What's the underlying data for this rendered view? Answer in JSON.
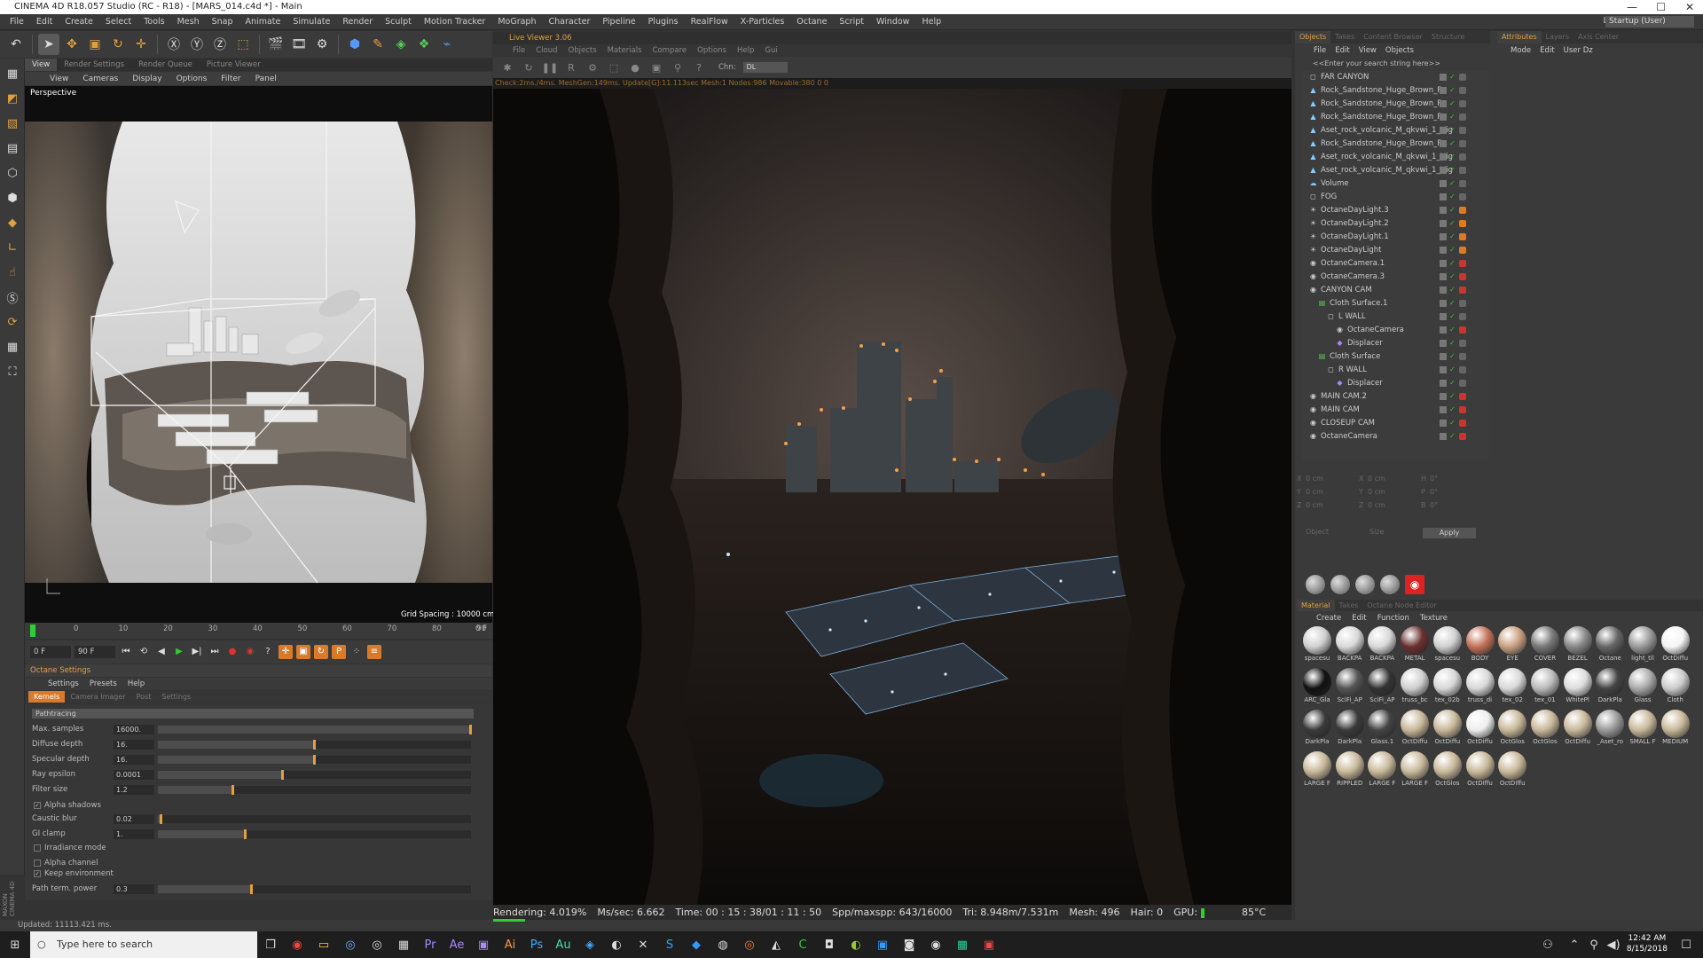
{
  "title_bar": {
    "title": "CINEMA 4D R18.057 Studio (RC - R18) - [MARS_014.c4d *] - Main"
  },
  "menubar": {
    "items": [
      "File",
      "Edit",
      "Create",
      "Select",
      "Tools",
      "Mesh",
      "Snap",
      "Animate",
      "Simulate",
      "Render",
      "Sculpt",
      "Motion Tracker",
      "MoGraph",
      "Character",
      "Pipeline",
      "Plugins",
      "RealFlow",
      "X-Particles",
      "Octane",
      "Script",
      "Window",
      "Help"
    ],
    "layout_label": "Layout:",
    "layout_value": "Startup (User)"
  },
  "viewport": {
    "tabs": [
      "View",
      "Render Settings",
      "Render Queue",
      "Picture Viewer"
    ],
    "menu": [
      "View",
      "Cameras",
      "Display",
      "Options",
      "Filter",
      "Panel"
    ],
    "label": "Perspective",
    "grid_spacing": "Grid Spacing : 10000 cm"
  },
  "timeline": {
    "ticks": [
      "0",
      "10",
      "20",
      "30",
      "40",
      "50",
      "60",
      "70",
      "80",
      "90"
    ],
    "end_field": "0 F",
    "start_field": "0 F",
    "max_field": "90 F"
  },
  "octane_settings": {
    "header": "Octane Settings",
    "menu": [
      "Settings",
      "Presets",
      "Help"
    ],
    "tabs": [
      "Kernels",
      "Camera Imager",
      "Post",
      "Settings"
    ],
    "kernel": "Pathtracing",
    "params": [
      {
        "label": "Max. samples",
        "value": "16000.",
        "fill": 1.0
      },
      {
        "label": "Diffuse depth",
        "value": "16.",
        "fill": 0.5
      },
      {
        "label": "Specular depth",
        "value": "16.",
        "fill": 0.5
      },
      {
        "label": "Ray epsilon",
        "value": "0.0001",
        "fill": 0.4
      },
      {
        "label": "Filter size",
        "value": "1.2",
        "fill": 0.24
      }
    ],
    "params2": [
      {
        "label": "Caustic blur",
        "value": "0.02",
        "fill": 0.01
      },
      {
        "label": "GI clamp",
        "value": "1.",
        "fill": 0.28
      }
    ],
    "checks": {
      "alpha_shadows": "Alpha shadows",
      "irradiance_mode": "Irradiance mode",
      "alpha_channel": "Alpha channel",
      "keep_environment": "Keep environment"
    },
    "path_term": {
      "label": "Path term. power",
      "value": "0.3",
      "fill": 0.3
    }
  },
  "status": {
    "text": "Updated: 11113.421 ms."
  },
  "maxon": "MAXON CINEMA 4D",
  "live_viewer": {
    "header": "Live Viewer 3.06",
    "menu": [
      "File",
      "Cloud",
      "Objects",
      "Materials",
      "Compare",
      "Options",
      "Help",
      "Gui"
    ],
    "chn_label": "Chn:",
    "chn_value": "DL",
    "info": "Check:2ms./4ms. MeshGen:149ms. Update[G]:11.113sec Mesh:1 Nodes:986 Movable:380  0 0",
    "status": {
      "rendering": "Rendering: 4.019%",
      "ms_sec": "Ms/sec: 6.662",
      "time": "Time: 00 : 15 : 38/01 : 11 : 50",
      "spp": "Spp/maxspp: 643/16000",
      "tri": "Tri: 8.948m/7.531m",
      "mesh": "Mesh: 496",
      "hair": "Hair: 0",
      "gpu": "GPU:",
      "temp": "85°C"
    },
    "progress": 0.04
  },
  "object_manager": {
    "tabs": [
      "Objects",
      "Takes",
      "Content Browser",
      "Structure"
    ],
    "menu": [
      "File",
      "Edit",
      "View",
      "Objects"
    ],
    "search_placeholder": "<<Enter your search string here>>",
    "items": [
      {
        "name": "FAR CANYON",
        "indent": 0,
        "icon": "object-icon"
      },
      {
        "name": "Rock_Sandstone_Huge_Brown_Ro",
        "indent": 0,
        "icon": "mesh-icon"
      },
      {
        "name": "Rock_Sandstone_Huge_Brown_Ro",
        "indent": 0,
        "icon": "mesh-icon"
      },
      {
        "name": "Rock_Sandstone_Huge_Brown_Ro",
        "indent": 0,
        "icon": "mesh-icon"
      },
      {
        "name": "Aset_rock_volcanic_M_qkvwi_1_Hig",
        "indent": 0,
        "icon": "mesh-icon"
      },
      {
        "name": "Rock_Sandstone_Huge_Brown_Ro",
        "indent": 0,
        "icon": "mesh-icon"
      },
      {
        "name": "Aset_rock_volcanic_M_qkvwi_1_Hig",
        "indent": 0,
        "icon": "mesh-icon"
      },
      {
        "name": "Aset_rock_volcanic_M_qkvwi_1_Hig",
        "indent": 0,
        "icon": "mesh-icon"
      },
      {
        "name": "Volume",
        "indent": 0,
        "icon": "volume-icon"
      },
      {
        "name": "FOG",
        "indent": 0,
        "icon": "object-icon"
      },
      {
        "name": "OctaneDayLight.3",
        "indent": 0,
        "icon": "light-icon"
      },
      {
        "name": "OctaneDayLight.2",
        "indent": 0,
        "icon": "light-icon"
      },
      {
        "name": "OctaneDayLight.1",
        "indent": 0,
        "icon": "light-icon"
      },
      {
        "name": "OctaneDayLight",
        "indent": 0,
        "icon": "light-icon"
      },
      {
        "name": "OctaneCamera.1",
        "indent": 0,
        "icon": "camera-icon"
      },
      {
        "name": "OctaneCamera.3",
        "indent": 0,
        "icon": "camera-icon"
      },
      {
        "name": "CANYON CAM",
        "indent": 0,
        "icon": "camera-icon"
      },
      {
        "name": "Cloth Surface.1",
        "indent": 1,
        "icon": "cloth-icon"
      },
      {
        "name": "L WALL",
        "indent": 2,
        "icon": "object-icon"
      },
      {
        "name": "OctaneCamera",
        "indent": 3,
        "icon": "camera-icon"
      },
      {
        "name": "Displacer",
        "indent": 3,
        "icon": "deformer-icon"
      },
      {
        "name": "Cloth Surface",
        "indent": 1,
        "icon": "cloth-icon"
      },
      {
        "name": "R WALL",
        "indent": 2,
        "icon": "object-icon"
      },
      {
        "name": "Displacer",
        "indent": 3,
        "icon": "deformer-icon"
      },
      {
        "name": "MAIN CAM.2",
        "indent": 0,
        "icon": "camera-icon"
      },
      {
        "name": "MAIN CAM",
        "indent": 0,
        "icon": "camera-icon"
      },
      {
        "name": "CLOSEUP CAM",
        "indent": 0,
        "icon": "camera-icon"
      },
      {
        "name": "OctaneCamera",
        "indent": 0,
        "icon": "camera-icon"
      }
    ]
  },
  "attributes": {
    "tabs": [
      "Attributes",
      "Layers",
      "Axis Center"
    ],
    "menu": [
      "Mode",
      "Edit",
      "User Dz"
    ]
  },
  "coordinates": {
    "rows": [
      {
        "a": "X",
        "av": "0 cm",
        "b": "X",
        "bv": "0 cm",
        "c": "H",
        "cv": "0°"
      },
      {
        "a": "Y",
        "av": "0 cm",
        "b": "Y",
        "bv": "0 cm",
        "c": "P",
        "cv": "0°"
      },
      {
        "a": "Z",
        "av": "0 cm",
        "b": "Z",
        "bv": "0 cm",
        "c": "B",
        "cv": "0°"
      }
    ],
    "mode_a": "Object",
    "mode_b": "Size",
    "apply": "Apply"
  },
  "material_manager": {
    "tabs": [
      "Material",
      "Takes",
      "Octane Node Editor"
    ],
    "menu": [
      "Create",
      "Edit",
      "Function",
      "Texture"
    ],
    "materials": [
      {
        "name": "spacesu",
        "color": "#cfcfcf"
      },
      {
        "name": "BACKPA",
        "color": "#d8d8d8"
      },
      {
        "name": "BACKPA",
        "color": "#d8d8d8"
      },
      {
        "name": "METAL",
        "color": "#6a3030"
      },
      {
        "name": "spacesu",
        "color": "#d0d0d0"
      },
      {
        "name": "BODY",
        "color": "#c47058"
      },
      {
        "name": "EYE",
        "color": "#c9a080"
      },
      {
        "name": "COVER",
        "color": "#777"
      },
      {
        "name": "BEZEL",
        "color": "#888"
      },
      {
        "name": "Octane",
        "color": "#666"
      },
      {
        "name": "light_til",
        "color": "#999"
      },
      {
        "name": "OctDiffu",
        "color": "#f5f5f5"
      },
      {
        "name": "ARC_Gla",
        "color": "#111"
      },
      {
        "name": "SciFi_AP",
        "color": "#555"
      },
      {
        "name": "SciFi_AP",
        "color": "#333"
      },
      {
        "name": "truss_bc",
        "color": "#d0d0d0"
      },
      {
        "name": "tex_02b",
        "color": "#d8d8d8"
      },
      {
        "name": "truss_di",
        "color": "#d8d8d8"
      },
      {
        "name": "tex_02",
        "color": "#d8d8d8"
      },
      {
        "name": "tex_01",
        "color": "#bbb"
      },
      {
        "name": "WhitePl",
        "color": "#ddd"
      },
      {
        "name": "DarkPla",
        "color": "#444"
      },
      {
        "name": "Glass",
        "color": "#aaa"
      },
      {
        "name": "Cloth",
        "color": "#ccc"
      },
      {
        "name": "DarkPla",
        "color": "#3a3a3a"
      },
      {
        "name": "DarkPla",
        "color": "#3a3a3a"
      },
      {
        "name": "Glass.1",
        "color": "#444"
      },
      {
        "name": "OctDiffu",
        "color": "#c8b89a"
      },
      {
        "name": "OctDiffu",
        "color": "#c8b89a"
      },
      {
        "name": "OctDiffu",
        "color": "#eee"
      },
      {
        "name": "OctGlos",
        "color": "#c8b89a"
      },
      {
        "name": "OctGlos",
        "color": "#c8b89a"
      },
      {
        "name": "OctDiffu",
        "color": "#c8b89a"
      },
      {
        "name": "_Aset_ro",
        "color": "#999"
      },
      {
        "name": "SMALL F",
        "color": "#c8b89a"
      },
      {
        "name": "MEDIUM",
        "color": "#c8b89a"
      },
      {
        "name": "LARGE F",
        "color": "#c8b89a"
      },
      {
        "name": "RIPPLED",
        "color": "#c8b89a"
      },
      {
        "name": "LARGE F",
        "color": "#c8b89a"
      },
      {
        "name": "LARGE F",
        "color": "#c8b89a"
      },
      {
        "name": "OctGlos",
        "color": "#c8b89a"
      },
      {
        "name": "OctDiffu",
        "color": "#c8b89a"
      },
      {
        "name": "OctDiffu",
        "color": "#c8b89a"
      }
    ]
  },
  "taskbar": {
    "search_placeholder": "Type here to search",
    "time": "12:42 AM",
    "date": "8/15/2018"
  },
  "colors": {
    "accent": "#e0a040",
    "render_bg": "#161616",
    "gpu_ok": "#33cc33"
  }
}
